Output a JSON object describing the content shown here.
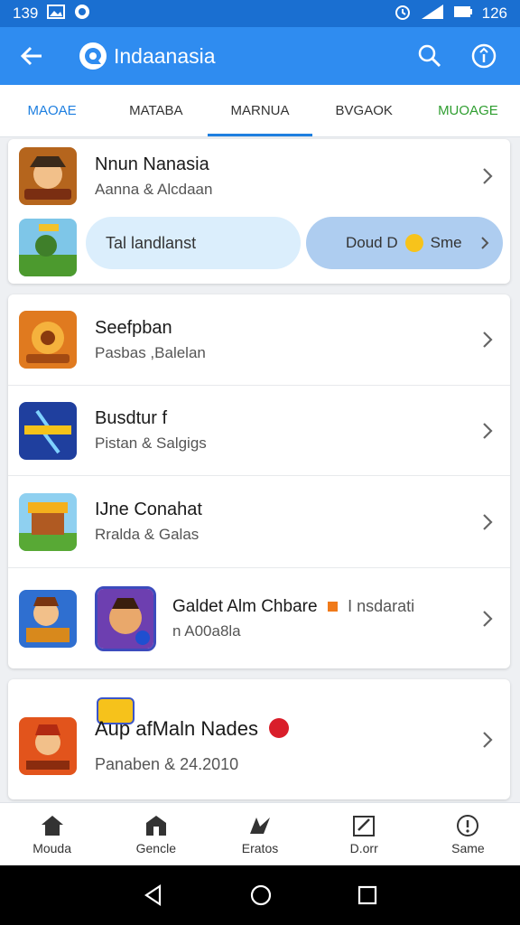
{
  "status_bar": {
    "time_left": "139",
    "time_right": "126"
  },
  "app_bar": {
    "title": "Indaanasia"
  },
  "tabs": [
    {
      "label": "MAOAE",
      "color": "#1e7fe0"
    },
    {
      "label": "MATABA"
    },
    {
      "label": "MARNUA",
      "active": true
    },
    {
      "label": "BVGAOK"
    },
    {
      "label": "MUOAGE",
      "color": "#2f9e30"
    }
  ],
  "featured": {
    "title": "Nnun Nanasia",
    "subtitle": "Aanna & Alcdaan",
    "pill_left": "Tal landlanst",
    "pill_right_prefix": "Doud D",
    "pill_right_suffix": "Sme"
  },
  "list": [
    {
      "title": "Seefpban",
      "subtitle": "Pasbas ,Balelan"
    },
    {
      "title": "Busdtur  f",
      "subtitle": "Pistan & Salgigs"
    },
    {
      "title": "IJne Conahat",
      "subtitle": "Rralda & Galas"
    },
    {
      "title": "Galdet Alm Chbare",
      "tag": "I nsdarati",
      "subtitle": "n A00a8la"
    }
  ],
  "promo": {
    "title": "Aup afMaln Nades",
    "subtitle": "Panaben  & 24.2010"
  },
  "bottom_nav": [
    {
      "label": "Mouda",
      "icon": "home-icon"
    },
    {
      "label": "Gencle",
      "icon": "store-icon"
    },
    {
      "label": "Eratos",
      "icon": "star-icon"
    },
    {
      "label": "D.orr",
      "icon": "edit-icon"
    },
    {
      "label": "Same",
      "icon": "info-icon"
    }
  ],
  "colors": {
    "status": "#1a6fd1",
    "appbar": "#2f8cf0",
    "accent": "#1e7fe0"
  }
}
